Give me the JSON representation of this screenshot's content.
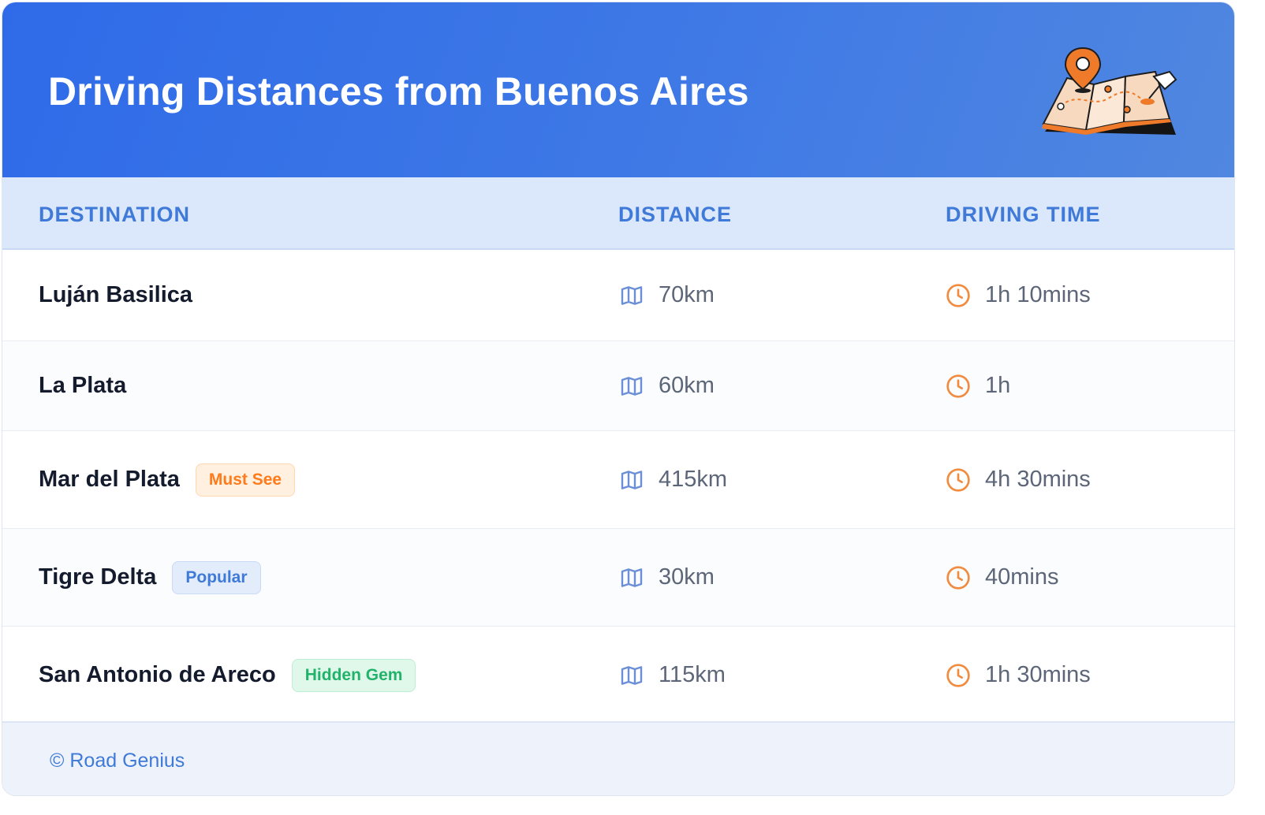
{
  "header": {
    "title": "Driving Distances from Buenos Aires",
    "illustration_icon": "map-with-pins-icon"
  },
  "columns": {
    "destination": "DESTINATION",
    "distance": "DISTANCE",
    "driving_time": "DRIVING TIME"
  },
  "rows": [
    {
      "destination": "Luján Basilica",
      "distance": "70km",
      "time": "1h 10mins",
      "badge": null
    },
    {
      "destination": "La Plata",
      "distance": "60km",
      "time": "1h",
      "badge": null
    },
    {
      "destination": "Mar del Plata",
      "distance": "415km",
      "time": "4h 30mins",
      "badge": "Must See"
    },
    {
      "destination": "Tigre Delta",
      "distance": "30km",
      "time": "40mins",
      "badge": "Popular"
    },
    {
      "destination": "San Antonio de Areco",
      "distance": "115km",
      "time": "1h 30mins",
      "badge": "Hidden Gem"
    }
  ],
  "icons": {
    "distance": "map-icon",
    "time": "clock-icon"
  },
  "footer": {
    "text": "© Road Genius"
  },
  "colors": {
    "header_start": "#2f6be8",
    "header_end": "#5087e0",
    "accent_blue": "#3f7ad9",
    "distance_icon": "#6b8fd6",
    "time_icon": "#f08b3f",
    "badge_must_see": "#ff7a1a",
    "badge_popular": "#3f7ad9",
    "badge_hidden_gem": "#22b36b"
  }
}
